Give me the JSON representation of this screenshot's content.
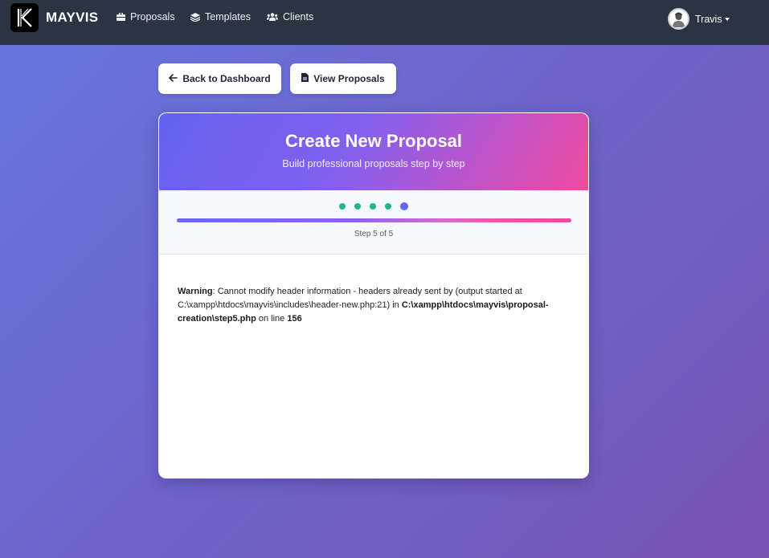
{
  "nav": {
    "brand": "MAYVIS",
    "items": [
      {
        "label": "Proposals",
        "icon": "briefcase-icon"
      },
      {
        "label": "Templates",
        "icon": "layers-icon"
      },
      {
        "label": "Clients",
        "icon": "users-icon"
      }
    ],
    "user": "Travis"
  },
  "actions": {
    "back": "Back to Dashboard",
    "view": "View Proposals"
  },
  "card": {
    "title": "Create New Proposal",
    "subtitle": "Build professional proposals step by step",
    "step_text": "Step 5 of 5",
    "total_steps": 5,
    "current_step": 5
  },
  "warning": {
    "label": "Warning",
    "message": ": Cannot modify header information - headers already sent by (output started at C:\\xampp\\htdocs\\mayvis\\includes\\header-new.php:21) in ",
    "file": "C:\\xampp\\htdocs\\mayvis\\proposal-creation\\step5.php",
    "line_text": " on line ",
    "line": "156"
  },
  "colors": {
    "navbar": "#2b3442",
    "accent": "#6366f1",
    "done": "#1fba82",
    "pink": "#ec4899"
  }
}
